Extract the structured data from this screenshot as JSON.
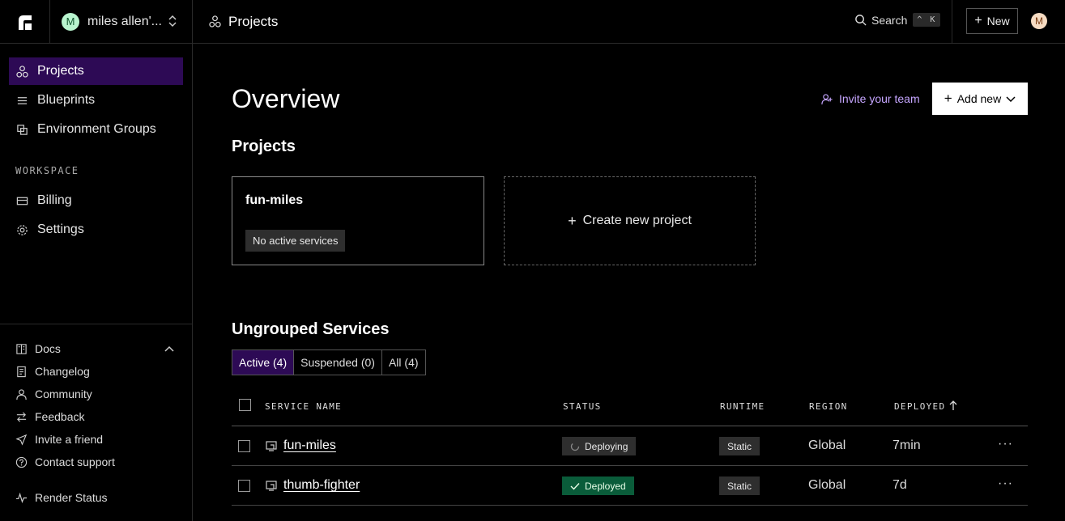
{
  "topbar": {
    "workspace_initial": "M",
    "workspace_name": "miles allen'...",
    "breadcrumb": "Projects",
    "search_label": "Search",
    "search_shortcut": "^ K",
    "new_label": "New",
    "user_initial": "M"
  },
  "sidebar": {
    "items": [
      {
        "label": "Projects",
        "icon": "projects-icon",
        "active": true
      },
      {
        "label": "Blueprints",
        "icon": "list-icon"
      },
      {
        "label": "Environment Groups",
        "icon": "env-groups-icon"
      }
    ],
    "workspace_label": "WORKSPACE",
    "workspace_items": [
      {
        "label": "Billing",
        "icon": "card-icon"
      },
      {
        "label": "Settings",
        "icon": "gear-icon"
      }
    ],
    "footer": [
      {
        "label": "Docs",
        "icon": "docs-icon"
      },
      {
        "label": "Changelog",
        "icon": "changelog-icon"
      },
      {
        "label": "Community",
        "icon": "community-icon"
      },
      {
        "label": "Feedback",
        "icon": "feedback-icon"
      },
      {
        "label": "Invite a friend",
        "icon": "send-icon"
      },
      {
        "label": "Contact support",
        "icon": "help-icon"
      },
      {
        "label": "Render Status",
        "icon": "pulse-icon"
      }
    ]
  },
  "main": {
    "title": "Overview",
    "invite_label": "Invite your team",
    "add_new_label": "Add new",
    "projects_heading": "Projects",
    "project_card": {
      "name": "fun-miles",
      "badge": "No active services"
    },
    "create_project_label": "Create new project",
    "ungrouped_heading": "Ungrouped Services",
    "tabs": [
      "Active (4)",
      "Suspended (0)",
      "All (4)"
    ],
    "columns": {
      "name": "SERVICE NAME",
      "status": "STATUS",
      "runtime": "RUNTIME",
      "region": "REGION",
      "deployed": "DEPLOYED"
    },
    "rows": [
      {
        "name": "fun-miles",
        "status": "Deploying",
        "runtime": "Static",
        "region": "Global",
        "deployed": "7min"
      },
      {
        "name": "thumb-fighter",
        "status": "Deployed",
        "runtime": "Static",
        "region": "Global",
        "deployed": "7d"
      }
    ],
    "more_label": "···"
  },
  "colors": {
    "accent": "#2d0a55",
    "link": "#c6a6ff",
    "deployed": "#0a5c3a"
  }
}
